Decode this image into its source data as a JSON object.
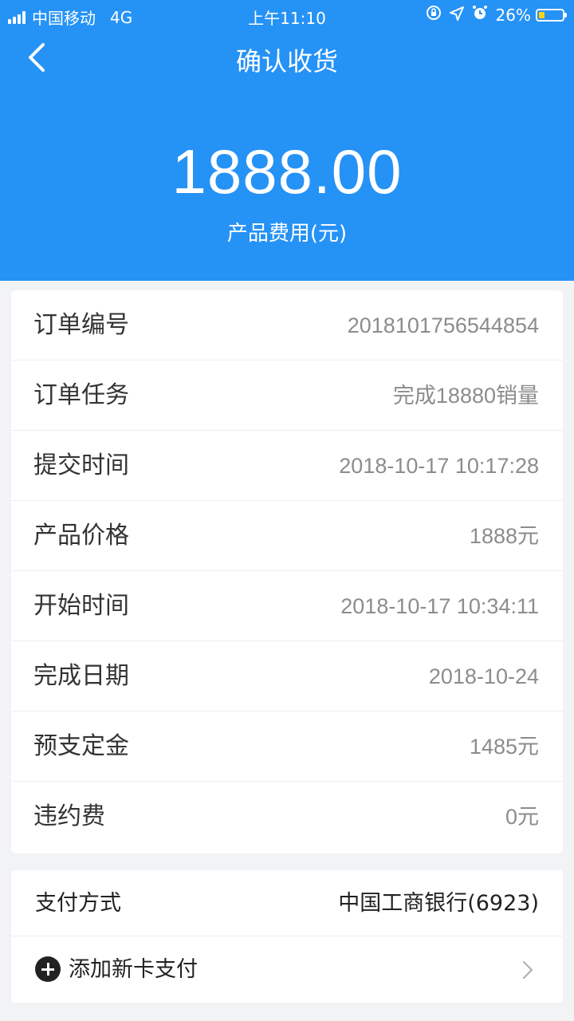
{
  "status_bar": {
    "carrier": "中国移动",
    "network": "4G",
    "time": "上午11:10",
    "battery_percent": "26%",
    "battery_level": 0.26,
    "icons": [
      "orientation-lock-icon",
      "location-icon",
      "alarm-icon"
    ]
  },
  "nav": {
    "title": "确认收货",
    "back_icon": "chevron-left-icon"
  },
  "summary": {
    "amount": "1888.00",
    "amount_label": "产品费用(元)"
  },
  "details": [
    {
      "label": "订单编号",
      "value": "2018101756544854"
    },
    {
      "label": "订单任务",
      "value": "完成18880销量"
    },
    {
      "label": "提交时间",
      "value": "2018-10-17 10:17:28"
    },
    {
      "label": "产品价格",
      "value": "1888元"
    },
    {
      "label": "开始时间",
      "value": "2018-10-17 10:34:11"
    },
    {
      "label": "完成日期",
      "value": "2018-10-24"
    },
    {
      "label": "预支定金",
      "value": "1485元"
    },
    {
      "label": "违约费",
      "value": "0元"
    }
  ],
  "payment": {
    "method_label": "支付方式",
    "method_value": "中国工商银行(6923)",
    "add_card_label": "添加新卡支付",
    "add_icon": "plus-circle-icon",
    "arrow_icon": "chevron-right-icon"
  },
  "colors": {
    "header_bg": "#2592f6",
    "page_bg": "#f2f3f5",
    "battery": "#ffd400"
  }
}
